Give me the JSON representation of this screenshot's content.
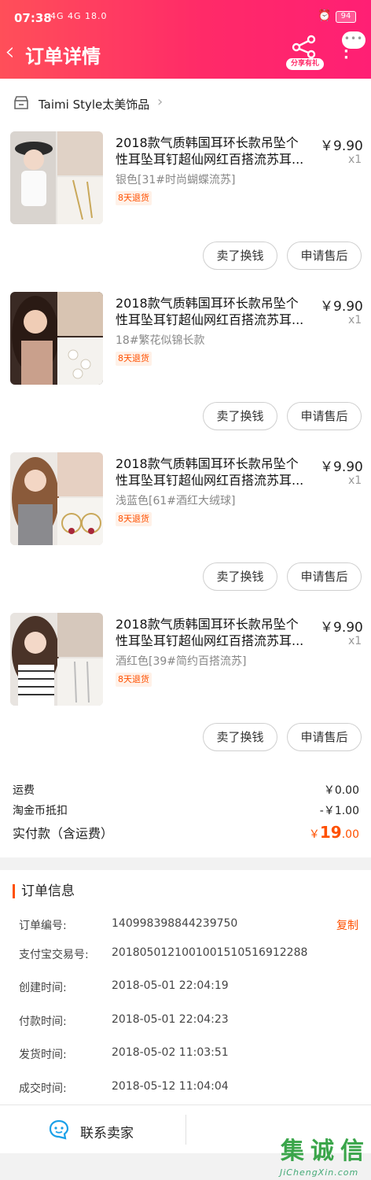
{
  "status_bar": {
    "time": "07:38",
    "network": "4G 4G  18.0",
    "battery": "94"
  },
  "header": {
    "title": "订单详情",
    "share_label": "分享有礼",
    "more_dots": "•••"
  },
  "shop": {
    "name": "Taimi Style太美饰品"
  },
  "items": [
    {
      "title_line1": "2018款气质韩国耳环长款吊坠个",
      "title_line2": "性耳坠耳钉超仙网红百搭流苏耳...",
      "sku": "银色[31#时尚蝴蝶流苏]",
      "tag": "8天退货",
      "price": "￥9.90",
      "qty": "x1",
      "sell_label": "卖了换钱",
      "service_label": "申请售后"
    },
    {
      "title_line1": "2018款气质韩国耳环长款吊坠个",
      "title_line2": "性耳坠耳钉超仙网红百搭流苏耳...",
      "sku": "18#繁花似锦长款",
      "tag": "8天退货",
      "price": "￥9.90",
      "qty": "x1",
      "sell_label": "卖了换钱",
      "service_label": "申请售后"
    },
    {
      "title_line1": "2018款气质韩国耳环长款吊坠个",
      "title_line2": "性耳坠耳钉超仙网红百搭流苏耳...",
      "sku": "浅蓝色[61#酒红大绒球]",
      "tag": "8天退货",
      "price": "￥9.90",
      "qty": "x1",
      "sell_label": "卖了换钱",
      "service_label": "申请售后"
    },
    {
      "title_line1": "2018款气质韩国耳环长款吊坠个",
      "title_line2": "性耳坠耳钉超仙网红百搭流苏耳...",
      "sku": "酒红色[39#简约百搭流苏]",
      "tag": "8天退货",
      "price": "￥9.90",
      "qty": "x1",
      "sell_label": "卖了换钱",
      "service_label": "申请售后"
    }
  ],
  "totals": {
    "shipping_label": "运费",
    "shipping_value": "￥0.00",
    "coin_label": "淘金币抵扣",
    "coin_value": "-￥1.00",
    "paid_label": "实付款（含运费）",
    "paid_currency": "￥",
    "paid_int": "19",
    "paid_dec": ".00"
  },
  "order_info": {
    "heading": "订单信息",
    "copy_label": "复制",
    "rows": [
      {
        "label": "订单编号:",
        "value": "140998398844239750"
      },
      {
        "label": "支付宝交易号:",
        "value": "2018050121001001510516912288"
      },
      {
        "label": "创建时间:",
        "value": "2018-05-01 22:04:19"
      },
      {
        "label": "付款时间:",
        "value": "2018-05-01 22:04:23"
      },
      {
        "label": "发货时间:",
        "value": "2018-05-02 11:03:51"
      },
      {
        "label": "成交时间:",
        "value": "2018-05-12 11:04:04"
      }
    ]
  },
  "footer": {
    "contact_label": "联系卖家"
  },
  "watermark": {
    "glyphs": [
      "集",
      "诚",
      "信"
    ],
    "url": "JiChengXin.com"
  },
  "colors": {
    "header_start": "#ff4f59",
    "header_end": "#ff1f74",
    "accent": "#ff5000"
  }
}
